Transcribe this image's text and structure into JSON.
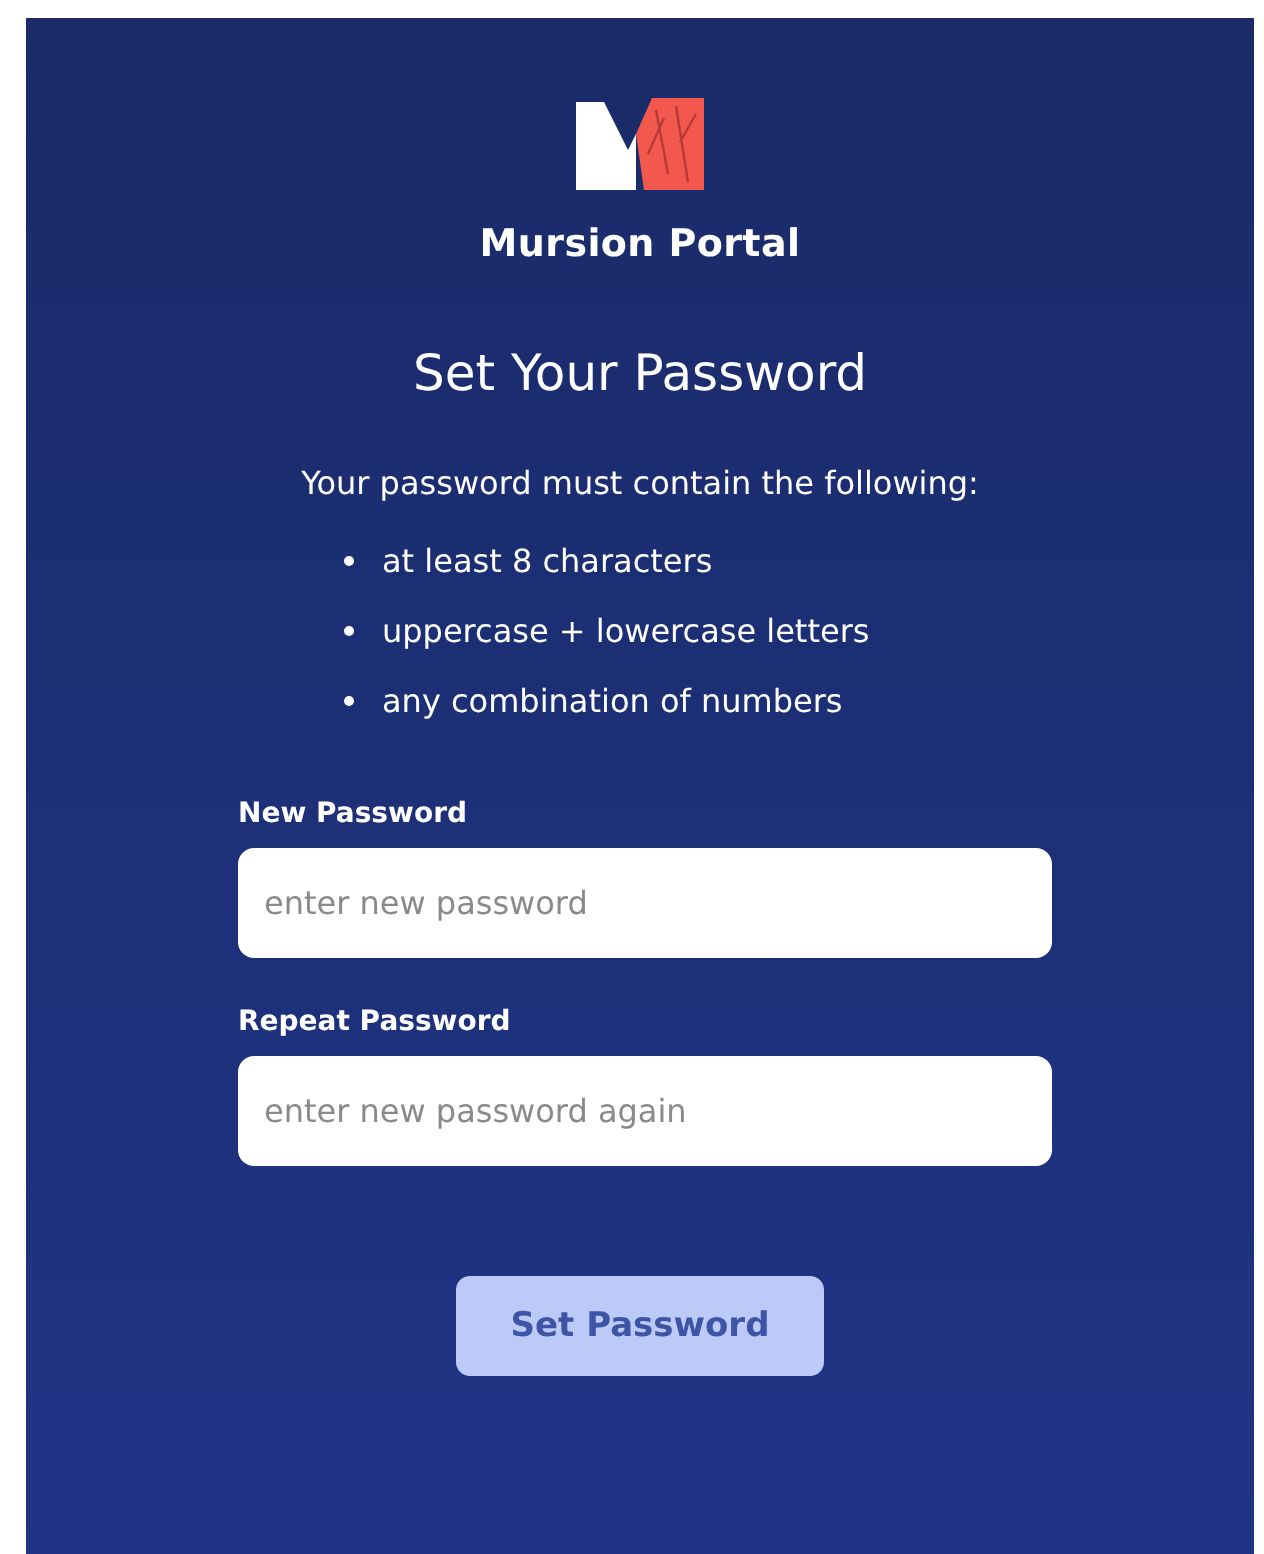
{
  "brand": {
    "name": "Mursion Portal"
  },
  "title": "Set Your Password",
  "requirements": {
    "intro": "Your password must contain the following:",
    "items": [
      "at least 8 characters",
      "uppercase + lowercase letters",
      "any combination of numbers"
    ]
  },
  "fields": [
    {
      "label": "New Password",
      "placeholder": "enter new password"
    },
    {
      "label": "Repeat Password",
      "placeholder": "enter new password again"
    }
  ],
  "submit": {
    "label": "Set Password",
    "disabled": true
  }
}
